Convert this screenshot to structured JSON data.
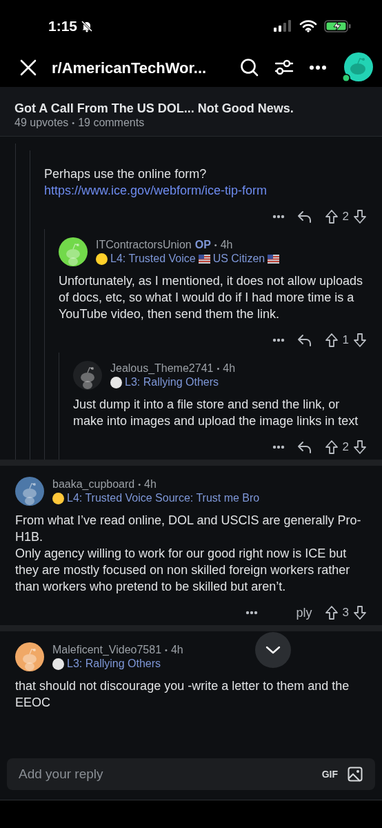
{
  "status_bar": {
    "time": "1:15",
    "silenced": true
  },
  "nav": {
    "title": "r/AmericanTechWor..."
  },
  "post": {
    "title": "Got A Call From The US DOL... Not Good News.",
    "upvotes": "49 upvotes",
    "separator": "•",
    "comments": "19 comments"
  },
  "threads": [
    {
      "children": [
        {
          "children": [
            {
              "body": [
                {
                  "kind": "text",
                  "text": "Perhaps use the online form? "
                },
                {
                  "kind": "link",
                  "text": "https://www.ice.gov/"
                },
                {
                  "kind": "link",
                  "text": "webform/ice-tip-form"
                }
              ],
              "actions": {
                "score": "2"
              },
              "children": [
                {
                  "author": "ITContractorsUnion",
                  "op": "OP",
                  "separator": "•",
                  "time": "4h",
                  "avatar": {
                    "color": "#72d94a"
                  },
                  "flair": {
                    "color": "#ffd02a",
                    "parts": [
                      {
                        "kind": "text",
                        "text": "L4: Trusted Voice"
                      },
                      {
                        "kind": "flag"
                      },
                      {
                        "kind": "text",
                        "text": "US Citizen"
                      },
                      {
                        "kind": "flag"
                      }
                    ]
                  },
                  "body": [
                    {
                      "kind": "text",
                      "text": "Unfortunately, as I mentioned, it does not allow uploads of docs, etc, so what I would do if I had more time is a YouTube  video, then send them the link."
                    }
                  ],
                  "actions": {
                    "score": "1"
                  },
                  "children": [
                    {
                      "author": "Jealous_Theme2741",
                      "separator": "•",
                      "time": "4h",
                      "avatar": {
                        "color": "#1f2124"
                      },
                      "flair": {
                        "color": "#e6e6e6",
                        "parts": [
                          {
                            "kind": "text",
                            "text": "L3: Rallying Others"
                          }
                        ]
                      },
                      "body": [
                        {
                          "kind": "text",
                          "text": "Just dump it into a file store and send the link, or make into images and upload the image links in text"
                        }
                      ],
                      "actions": {
                        "score": "2"
                      }
                    }
                  ]
                }
              ]
            }
          ]
        }
      ]
    },
    {
      "author": "baaka_cupboard",
      "separator": "•",
      "time": "4h",
      "avatar": {
        "color": "#4d78a8"
      },
      "flair": {
        "color": "#ffc73a",
        "parts": [
          {
            "kind": "text",
            "text": "L4: Trusted Voice Source: Trust me Bro"
          }
        ]
      },
      "body": [
        {
          "kind": "text",
          "text": "From what I’ve read online, DOL and USCIS are generally Pro- H1B.\nOnly agency willing to work for our good right now is ICE but they are mostly focused on non skilled foreign workers rather than workers who pretend to be skilled but aren’t."
        }
      ],
      "actions": {
        "score": "3",
        "reply_label": "ply"
      }
    },
    {
      "author": "Maleficent_Video7581",
      "separator": "•",
      "time": "4h",
      "avatar": {
        "color": "#f0a866"
      },
      "flair": {
        "color": "#e6e6e6",
        "parts": [
          {
            "kind": "text",
            "text": "L3: Rallying Others"
          }
        ]
      },
      "body": [
        {
          "kind": "text",
          "text": "that should not discourage you -write a letter to them and the EEOC"
        }
      ]
    }
  ],
  "reply_bar": {
    "placeholder": "Add your reply",
    "gif": "GIF"
  }
}
